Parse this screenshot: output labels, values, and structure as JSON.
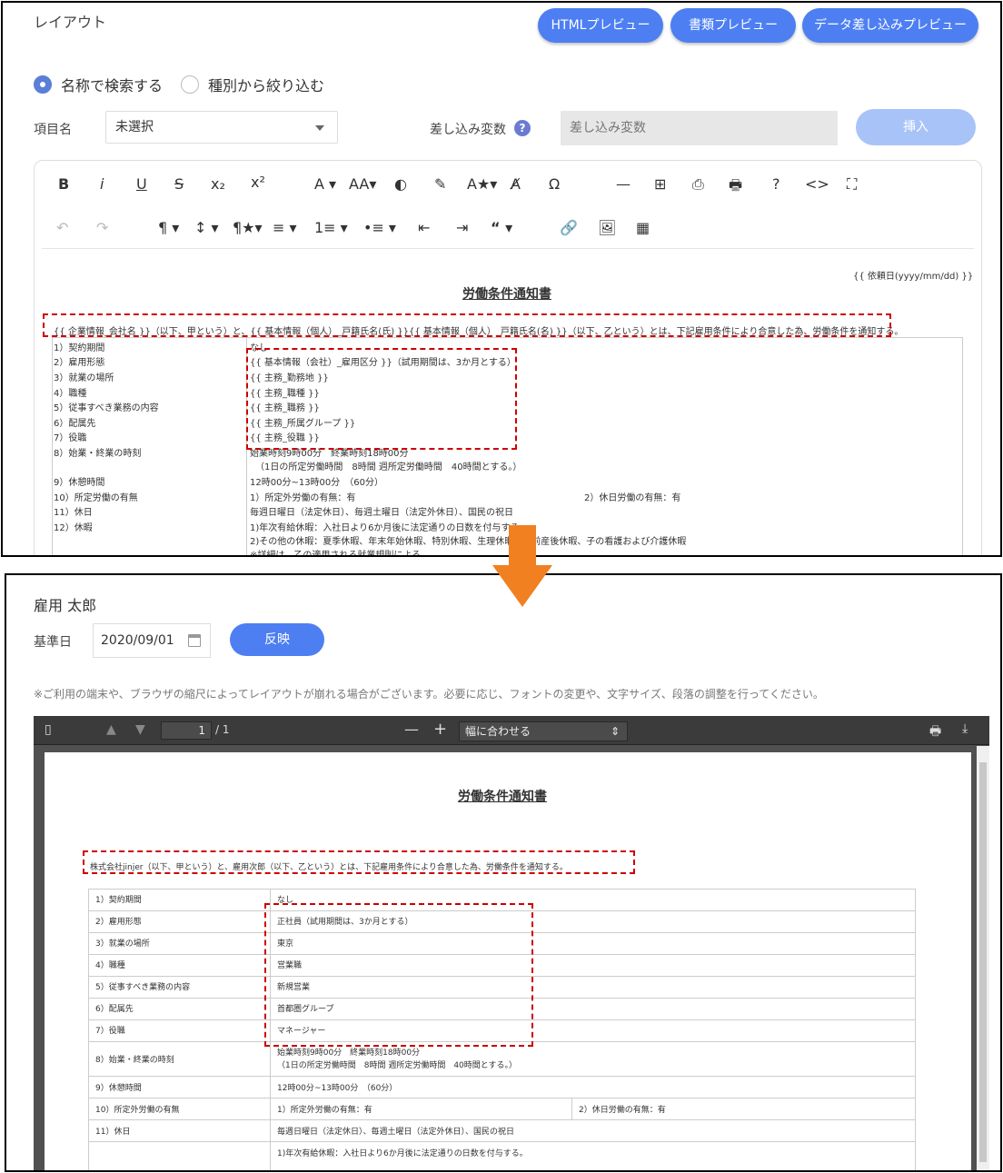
{
  "top": {
    "title": "レイアウト",
    "buttons": {
      "html_preview": "HTMLプレビュー",
      "doc_preview": "書類プレビュー",
      "data_preview": "データ差し込みプレビュー"
    },
    "radio": {
      "by_name": "名称で検索する",
      "by_type": "種別から絞り込む"
    },
    "item_label": "項目名",
    "item_value": "未選択",
    "var_label": "差し込み変数",
    "var_placeholder": "差し込み変数",
    "insert": "挿入",
    "toolbar_row1": [
      "B",
      "i",
      "U",
      "S",
      "x₂",
      "x²",
      "A ▾",
      "AA▾",
      "◐",
      "✎",
      "A★▾",
      "A̸",
      "Ω",
      "—",
      "⊞",
      "⎙",
      "🖶",
      "?",
      "<>",
      "⛶"
    ],
    "toolbar_row2": [
      "↶",
      "↷",
      "¶ ▾",
      "↕ ▾",
      "¶★▾",
      "≡ ▾",
      "1≡ ▾",
      "•≡ ▾",
      "⇤",
      "⇥",
      "“ ▾",
      "🔗",
      "🖼",
      "▦"
    ],
    "doc": {
      "date_var": "{{ 依頼日(yyyy/mm/dd) }}",
      "title": "労働条件通知書",
      "intro": "{{ 企業情報_会社名 }}（以下、甲という）と、{{ 基本情報（個人）_戸籍氏名(氏) }}{{ 基本情報（個人）_戸籍氏名(名) }}（以下、乙という）とは、下記雇用条件により合意した為、労働条件を通知する。",
      "rows": [
        {
          "label": "1）契約期間",
          "value": "なし"
        },
        {
          "label": "2）雇用形態",
          "value": "{{ 基本情報（会社）_雇用区分 }}（試用期間は、3か月とする）"
        },
        {
          "label": "3）就業の場所",
          "value": "{{ 主務_勤務地 }}"
        },
        {
          "label": "4）職種",
          "value": "{{ 主務_職種 }}"
        },
        {
          "label": "5）従事すべき業務の内容",
          "value": "{{ 主務_職務 }}"
        },
        {
          "label": "6）配属先",
          "value": "{{ 主務_所属グループ }}"
        },
        {
          "label": "7）役職",
          "value": "{{ 主務_役職 }}"
        },
        {
          "label": "8）始業・終業の時刻",
          "value": "始業時刻9時00分　終業時刻18時00分",
          "value2": "（1日の所定労働時間　8時間 週所定労働時間　40時間とする。）"
        },
        {
          "label": "9）休憩時間",
          "value": "12時00分~13時00分　（60分）"
        },
        {
          "label": "10）所定労働の有無",
          "value": "1）所定外労働の有無：有",
          "extra": "2）休日労働の有無：有"
        },
        {
          "label": "11）休日",
          "value": "毎週日曜日（法定休日）、毎週土曜日（法定外休日）、国民の祝日"
        },
        {
          "label": "12）休暇",
          "value": "1)年次有給休暇：入社日より6か月後に法定通りの日数を付与する。",
          "value2": "2)その他の休暇：夏季休暇、年末年始休暇、特別休暇、生理休暇、産前産後休暇、子の看護および介護休暇",
          "value3": "※詳細は、乙の適用される就業規則による。"
        }
      ]
    }
  },
  "bottom": {
    "person": "雇用 太郎",
    "date_label": "基準日",
    "date_value": "2020/09/01",
    "reflect": "反映",
    "notice": "※ご利用の端末や、ブラウザの縮尺によってレイアウトが崩れる場合がございます。必要に応じ、フォントの変更や、文字サイズ、段落の調整を行ってください。",
    "viewer": {
      "page": "1",
      "total": "/ 1",
      "zoom": "幅に合わせる"
    },
    "doc": {
      "title": "労働条件通知書",
      "intro": "株式会社jinjer（以下、甲という）と、雇用次郎（以下、乙という）とは、下記雇用条件により合意した為、労働条件を通知する。",
      "rows": [
        {
          "label": "1）契約期間",
          "value": "なし"
        },
        {
          "label": "2）雇用形態",
          "value": "正社員（試用期間は、3か月とする）"
        },
        {
          "label": "3）就業の場所",
          "value": "東京"
        },
        {
          "label": "4）職種",
          "value": "営業職"
        },
        {
          "label": "5）従事すべき業務の内容",
          "value": "新規営業"
        },
        {
          "label": "6）配属先",
          "value": "首都圏グループ"
        },
        {
          "label": "7）役職",
          "value": "マネージャー"
        },
        {
          "label": "8）始業・終業の時刻",
          "value": "始業時刻9時00分　終業時刻18時00分",
          "value2": "（1日の所定労働時間　8時間 週所定労働時間　40時間とする。）"
        },
        {
          "label": "9）休憩時間",
          "value": "12時00分~13時00分　（60分）"
        },
        {
          "label": "10）所定外労働の有無",
          "value": "1）所定外労働の有無：有",
          "extra": "2）休日労働の有無：有"
        },
        {
          "label": "11）休日",
          "value": "毎週日曜日（法定休日）、毎週土曜日（法定外休日）、国民の祝日"
        },
        {
          "label": "",
          "value": "1)年次有給休暇：入社日より6か月後に法定通りの日数を付与する。"
        }
      ]
    }
  },
  "colors": {
    "accent": "#4d7ff2",
    "highlight": "#cc0000",
    "arrow": "#f08020"
  }
}
